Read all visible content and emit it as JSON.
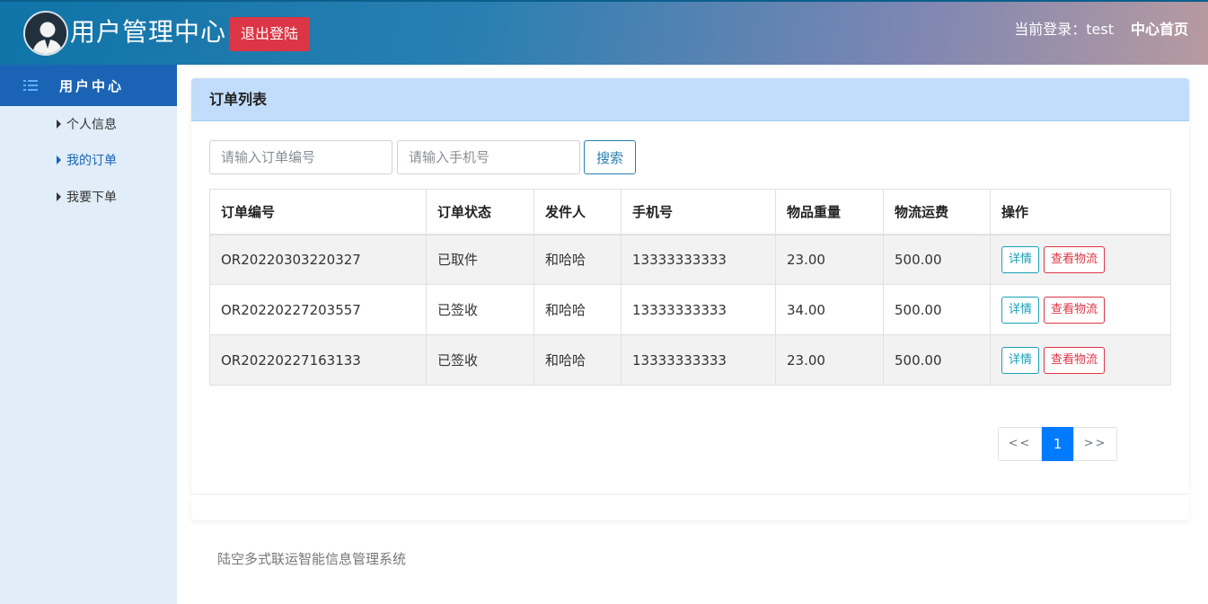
{
  "header": {
    "title": "用户管理中心",
    "logout_label": "退出登陆",
    "current_user": "当前登录：test",
    "home_label": "中心首页"
  },
  "sidebar": {
    "heading": "用户中心",
    "items": [
      {
        "label": "个人信息",
        "active": false
      },
      {
        "label": "我的订单",
        "active": true
      },
      {
        "label": "我要下单",
        "active": false
      }
    ]
  },
  "panel": {
    "title": "订单列表",
    "search": {
      "order_placeholder": "请输入订单编号",
      "phone_placeholder": "请输入手机号",
      "button_label": "搜索"
    },
    "table": {
      "columns": [
        "订单编号",
        "订单状态",
        "发件人",
        "手机号",
        "物品重量",
        "物流运费",
        "操作"
      ],
      "rows": [
        {
          "order_no": "OR20220303220327",
          "status": "已取件",
          "sender": "和哈哈",
          "phone": "13333333333",
          "weight": "23.00",
          "fee": "500.00"
        },
        {
          "order_no": "OR20220227203557",
          "status": "已签收",
          "sender": "和哈哈",
          "phone": "13333333333",
          "weight": "34.00",
          "fee": "500.00"
        },
        {
          "order_no": "OR20220227163133",
          "status": "已签收",
          "sender": "和哈哈",
          "phone": "13333333333",
          "weight": "23.00",
          "fee": "500.00"
        }
      ],
      "detail_label": "详情",
      "track_label": "查看物流"
    },
    "pagination": {
      "prev": "<<",
      "current": "1",
      "next": ">>"
    }
  },
  "footer": {
    "text": "陆空多式联运智能信息管理系统"
  },
  "colors": {
    "accent": "#1b63b4",
    "danger": "#dc3545",
    "info": "#17a2b8",
    "primary": "#007bff"
  }
}
